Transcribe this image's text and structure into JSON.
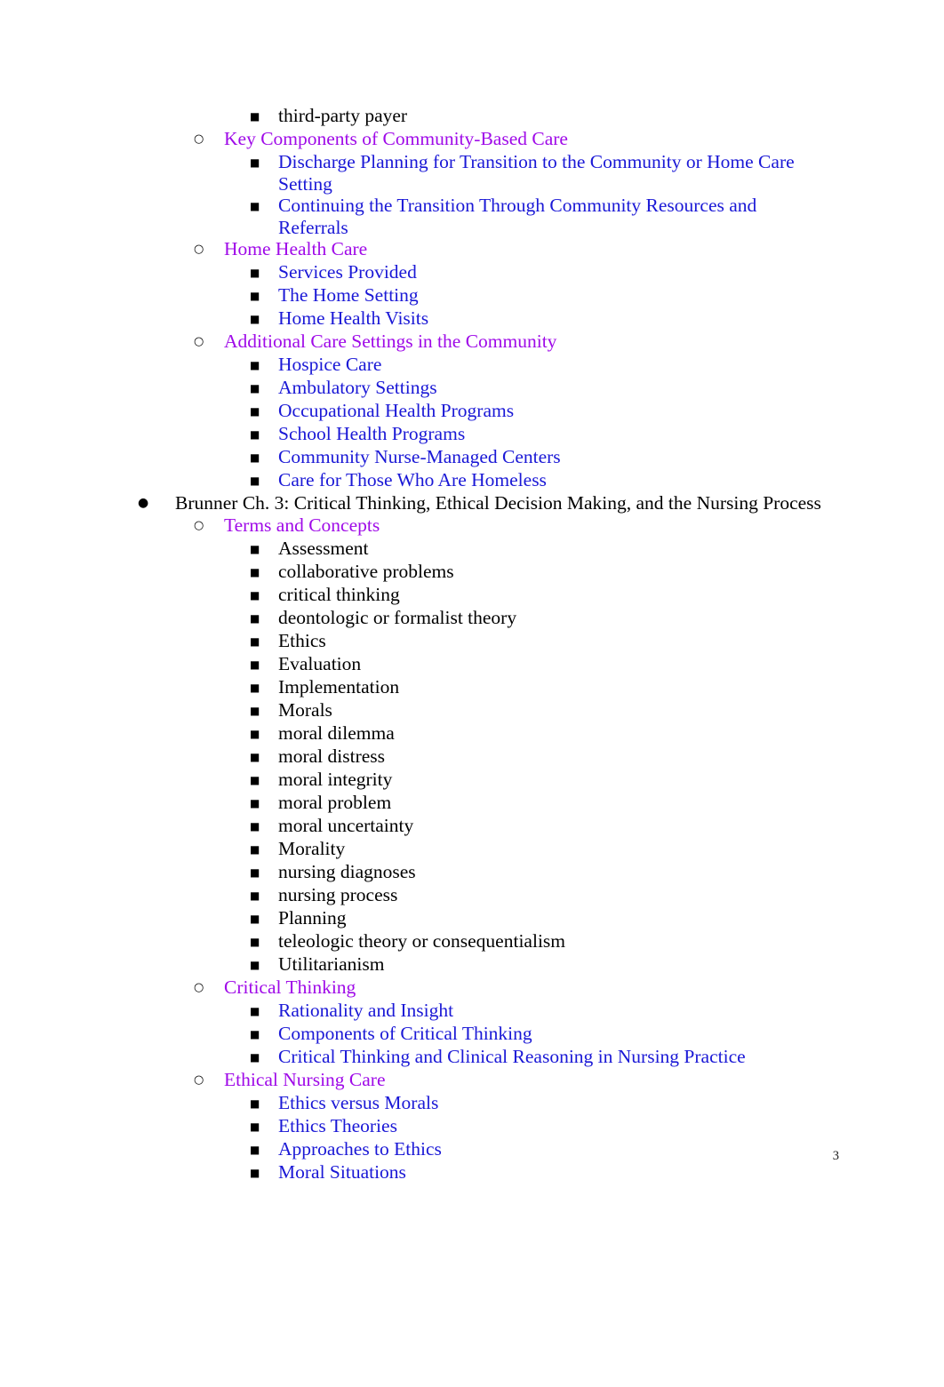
{
  "document": {
    "page_number": "3",
    "colors": {
      "level2_heading": "#9f0ae8",
      "level3_subheading": "#1a18d6",
      "body_text": "#000000"
    },
    "bullets": {
      "level1": "●",
      "level2": "○",
      "level3": "■"
    }
  },
  "outline": [
    {
      "id": "i0",
      "level": 3,
      "color": "black",
      "text": "third-party payer"
    },
    {
      "id": "i1",
      "level": 2,
      "color": "purple",
      "text": "Key Components of Community-Based Care"
    },
    {
      "id": "i2",
      "level": 3,
      "color": "blue",
      "text": "Discharge Planning for Transition to the Community or Home Care Setting"
    },
    {
      "id": "i3",
      "level": 3,
      "color": "blue",
      "text": "Continuing the Transition Through Community Resources and Referrals"
    },
    {
      "id": "i4",
      "level": 2,
      "color": "purple",
      "text": "Home Health Care"
    },
    {
      "id": "i5",
      "level": 3,
      "color": "blue",
      "text": "Services Provided"
    },
    {
      "id": "i6",
      "level": 3,
      "color": "blue",
      "text": "The Home Setting"
    },
    {
      "id": "i7",
      "level": 3,
      "color": "blue",
      "text": "Home Health Visits"
    },
    {
      "id": "i8",
      "level": 2,
      "color": "purple",
      "text": "Additional Care Settings in the Community"
    },
    {
      "id": "i9",
      "level": 3,
      "color": "blue",
      "text": "Hospice Care"
    },
    {
      "id": "i10",
      "level": 3,
      "color": "blue",
      "text": "Ambulatory Settings"
    },
    {
      "id": "i11",
      "level": 3,
      "color": "blue",
      "text": "Occupational Health Programs"
    },
    {
      "id": "i12",
      "level": 3,
      "color": "blue",
      "text": "School Health Programs"
    },
    {
      "id": "i13",
      "level": 3,
      "color": "blue",
      "text": "Community Nurse-Managed Centers"
    },
    {
      "id": "i14",
      "level": 3,
      "color": "blue",
      "text": "Care for Those Who Are Homeless"
    },
    {
      "id": "i15",
      "level": 1,
      "color": "black",
      "text": "Brunner Ch. 3: Critical Thinking, Ethical Decision Making, and the Nursing Process"
    },
    {
      "id": "i16",
      "level": 2,
      "color": "purple",
      "text": "Terms and Concepts"
    },
    {
      "id": "i17",
      "level": 3,
      "color": "black",
      "text": "Assessment"
    },
    {
      "id": "i18",
      "level": 3,
      "color": "black",
      "text": "collaborative problems"
    },
    {
      "id": "i19",
      "level": 3,
      "color": "black",
      "text": "critical thinking"
    },
    {
      "id": "i20",
      "level": 3,
      "color": "black",
      "text": "deontologic or formalist theory"
    },
    {
      "id": "i21",
      "level": 3,
      "color": "black",
      "text": "Ethics"
    },
    {
      "id": "i22",
      "level": 3,
      "color": "black",
      "text": "Evaluation"
    },
    {
      "id": "i23",
      "level": 3,
      "color": "black",
      "text": "Implementation"
    },
    {
      "id": "i24",
      "level": 3,
      "color": "black",
      "text": "Morals"
    },
    {
      "id": "i25",
      "level": 3,
      "color": "black",
      "text": "moral dilemma"
    },
    {
      "id": "i26",
      "level": 3,
      "color": "black",
      "text": "moral distress"
    },
    {
      "id": "i27",
      "level": 3,
      "color": "black",
      "text": "moral integrity"
    },
    {
      "id": "i28",
      "level": 3,
      "color": "black",
      "text": "moral problem"
    },
    {
      "id": "i29",
      "level": 3,
      "color": "black",
      "text": "moral uncertainty"
    },
    {
      "id": "i30",
      "level": 3,
      "color": "black",
      "text": "Morality"
    },
    {
      "id": "i31",
      "level": 3,
      "color": "black",
      "text": "nursing diagnoses"
    },
    {
      "id": "i32",
      "level": 3,
      "color": "black",
      "text": "nursing process"
    },
    {
      "id": "i33",
      "level": 3,
      "color": "black",
      "text": "Planning"
    },
    {
      "id": "i34",
      "level": 3,
      "color": "black",
      "text": "teleologic theory or consequentialism"
    },
    {
      "id": "i35",
      "level": 3,
      "color": "black",
      "text": "Utilitarianism"
    },
    {
      "id": "i36",
      "level": 2,
      "color": "purple",
      "text": "Critical Thinking"
    },
    {
      "id": "i37",
      "level": 3,
      "color": "blue",
      "text": "Rationality and Insight"
    },
    {
      "id": "i38",
      "level": 3,
      "color": "blue",
      "text": "Components of Critical Thinking"
    },
    {
      "id": "i39",
      "level": 3,
      "color": "blue",
      "text": "Critical Thinking and Clinical Reasoning in Nursing Practice"
    },
    {
      "id": "i40",
      "level": 2,
      "color": "purple",
      "text": "Ethical Nursing Care"
    },
    {
      "id": "i41",
      "level": 3,
      "color": "blue",
      "text": "Ethics versus Morals"
    },
    {
      "id": "i42",
      "level": 3,
      "color": "blue",
      "text": "Ethics Theories"
    },
    {
      "id": "i43",
      "level": 3,
      "color": "blue",
      "text": "Approaches to Ethics"
    },
    {
      "id": "i44",
      "level": 3,
      "color": "blue",
      "text": "Moral Situations"
    }
  ]
}
